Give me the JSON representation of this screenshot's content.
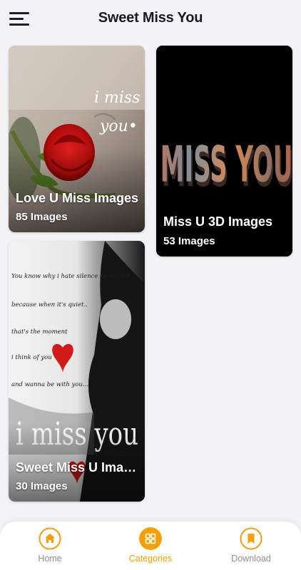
{
  "header": {
    "title": "Sweet Miss You",
    "menu_icon": "hamburger-menu-icon"
  },
  "categories": [
    {
      "title": "Love U Miss Images",
      "count": "85 Images",
      "art_text_line1": "i miss",
      "art_text_line2": "you•"
    },
    {
      "title": "Miss U 3D Images",
      "count": "53 Images",
      "art_text": "I MISS YOU!"
    },
    {
      "title": "Sweet Miss U Imag...",
      "count": "30 Images",
      "art_lines": [
        "You know why i hate silence so much?",
        "because when it's quiet..",
        "that's the moment",
        "i think of you",
        "and wanna be with you..."
      ],
      "art_caption": "i miss you"
    }
  ],
  "bottom_nav": {
    "items": [
      {
        "label": "Home",
        "icon": "home-icon",
        "active": false
      },
      {
        "label": "Categories",
        "icon": "grid-icon",
        "active": true
      },
      {
        "label": "Download",
        "icon": "bookmark-icon",
        "active": false
      }
    ]
  },
  "colors": {
    "accent": "#f5a000",
    "accent_ring": "#f39c12",
    "background": "#f2f2f7",
    "inactive_label": "#8e8e93"
  }
}
